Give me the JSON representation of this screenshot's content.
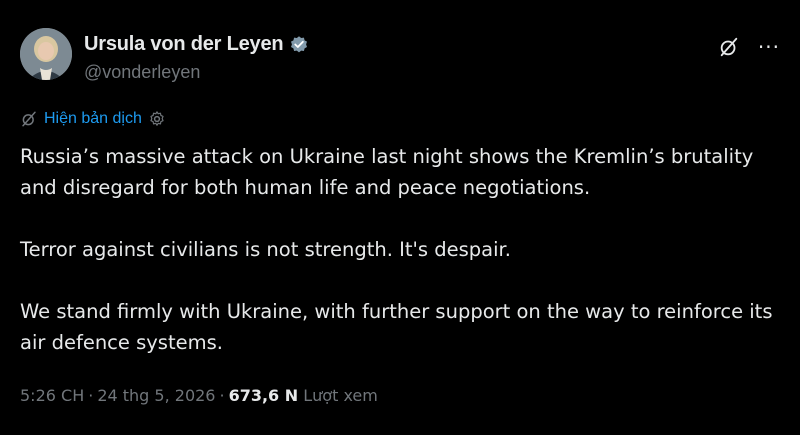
{
  "author": {
    "display_name": "Ursula von der Leyen",
    "handle": "@vonderleyen",
    "verified": true,
    "avatar_icon": "profile-photo"
  },
  "actions": {
    "grok_icon": "grok-icon",
    "more_icon": "more-icon",
    "more_label": "···"
  },
  "translation": {
    "label": "Hiện bản dịch",
    "icon": "translate-icon",
    "settings_icon": "gear-icon"
  },
  "tweet": {
    "paragraphs": [
      "Russia’s massive attack on Ukraine last night shows the Kremlin’s brutality and disregard for both human life and peace negotiations.",
      "Terror against civilians is not strength. It's despair.",
      "We stand firmly with Ukraine, with further support on the way to reinforce its air defence systems."
    ]
  },
  "meta": {
    "time": "5:26 CH",
    "separator": "·",
    "date": "24 thg 5, 2026",
    "views_count": "673,6 N",
    "views_label": "Lượt xem"
  },
  "colors": {
    "background": "#000000",
    "text": "#e7e9ea",
    "muted": "#71767b",
    "accent": "#1d9bf0",
    "verified": "#829aab"
  }
}
